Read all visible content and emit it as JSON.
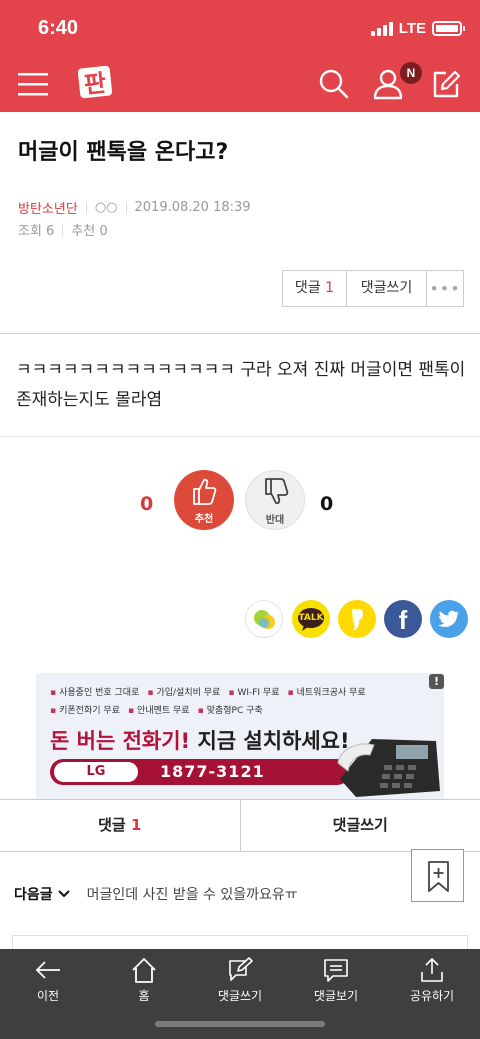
{
  "status_bar": {
    "time": "6:40",
    "network": "LTE"
  },
  "header": {
    "logo_text": "판",
    "notification_badge": "N"
  },
  "post": {
    "title": "머글이 팬톡을 온다고?",
    "author": "방탄소년단",
    "author_extra": "○○",
    "date": "2019.08.20 18:39",
    "views": "조회 6",
    "recommends": "추천 0",
    "body": "ㅋㅋㅋㅋㅋㅋㅋㅋㅋㅋㅋㅋㅋㅋ 구라 오져 진짜 머글이면 팬톡이 존재하는지도 몰라염"
  },
  "actions": {
    "comment_label": "댓글",
    "comment_count": "1",
    "write_comment": "댓글쓰기",
    "more": "•••"
  },
  "vote": {
    "up_count": "0",
    "up_label": "추천",
    "down_count": "0",
    "down_label": "반대"
  },
  "share": {
    "kakaotalk_label": "TALK",
    "facebook_glyph": "f"
  },
  "ad": {
    "row1": [
      "사용중인 번호 그대로",
      "가입/설치비 무료",
      "WI-FI 무료",
      "네트워크공사 무료"
    ],
    "row2": [
      "키폰전화기 무료",
      "안내멘트 무료",
      "맞춤형PC 구축"
    ],
    "headline_red": "돈 버는 전화기!",
    "headline_dark": "지금 설치하세요!",
    "brand": "LG",
    "phone": "1877-3121",
    "info_icon": "!"
  },
  "tabs": {
    "comment_label": "댓글",
    "comment_count": "1",
    "write_label": "댓글쓰기"
  },
  "next_post": {
    "label": "다음글",
    "title": "머글인데 사진 받을 수 있을까요유ㅠ"
  },
  "bottom_nav": [
    "이전",
    "홈",
    "댓글쓰기",
    "댓글보기",
    "공유하기"
  ],
  "colors": {
    "brand_red": "#e3434a",
    "accent_red": "#d63a3f",
    "tabbar": "#3f3f3f"
  }
}
